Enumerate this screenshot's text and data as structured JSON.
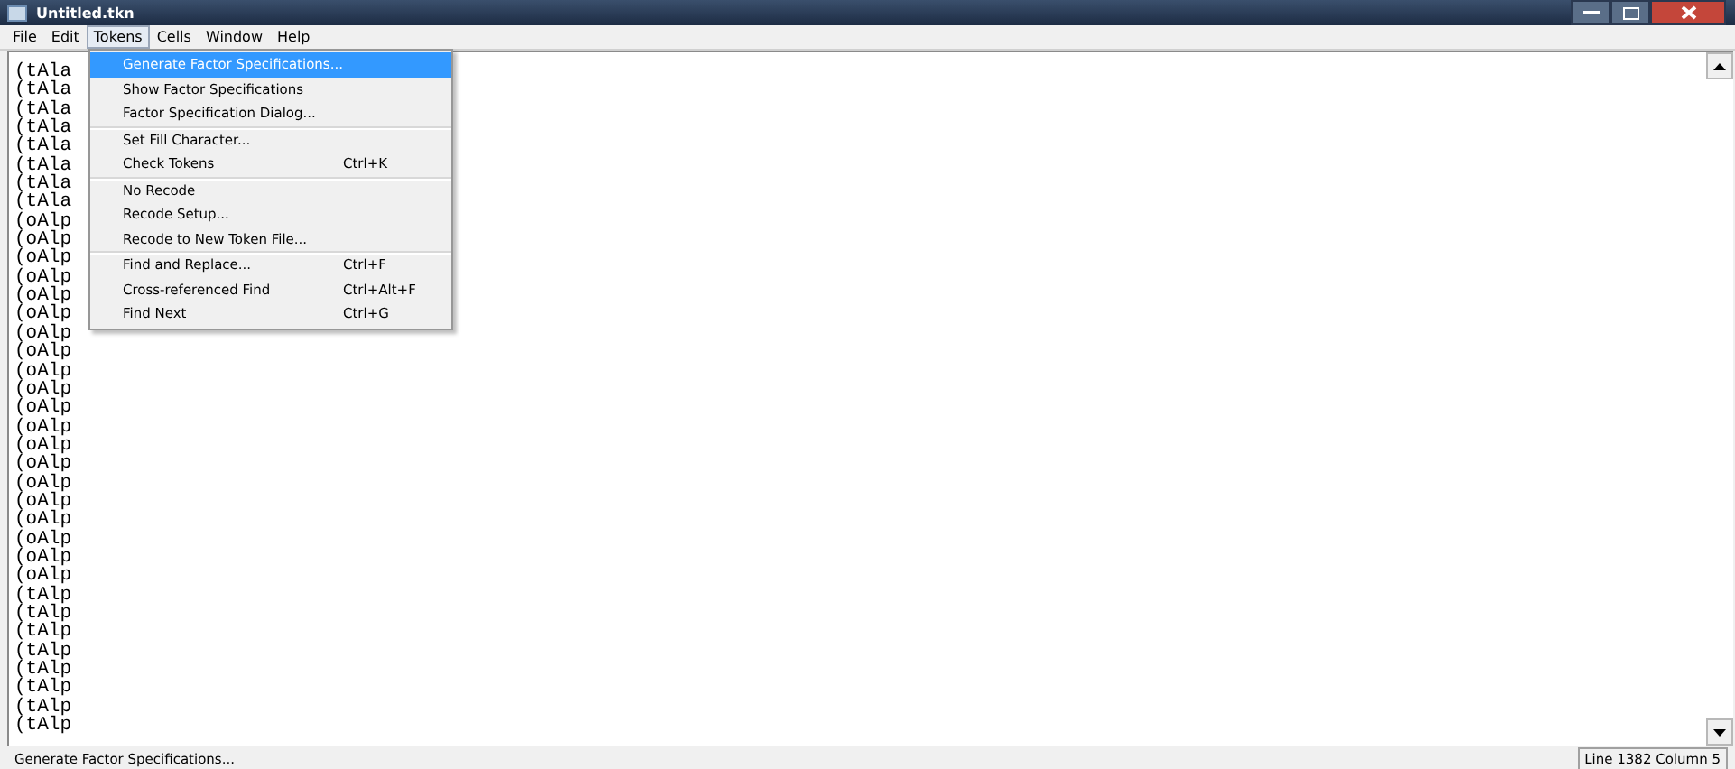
{
  "window": {
    "title": "Untitled.tkn"
  },
  "menu_bar": [
    {
      "label": "File",
      "selected": false
    },
    {
      "label": "Edit",
      "selected": false
    },
    {
      "label": "Tokens",
      "selected": true
    },
    {
      "label": "Cells",
      "selected": false
    },
    {
      "label": "Window",
      "selected": false
    },
    {
      "label": "Help",
      "selected": false
    }
  ],
  "dropdown": {
    "groups": [
      [
        {
          "label": "Generate Factor Specifications...",
          "selected": true
        },
        {
          "label": "Show Factor Specifications",
          "selected": false
        },
        {
          "label": "Factor Specification Dialog...",
          "selected": false
        }
      ],
      [
        {
          "label": "Set Fill Character...",
          "selected": false
        },
        {
          "label": "Check Tokens",
          "shortcut": "Ctrl+K",
          "selected": false
        }
      ],
      [
        {
          "label": "No Recode",
          "selected": false
        },
        {
          "label": "Recode Setup...",
          "selected": false
        },
        {
          "label": "Recode to New Token File...",
          "selected": false
        }
      ],
      [
        {
          "label": "Find and Replace...",
          "shortcut": "Ctrl+F",
          "selected": false
        },
        {
          "label": "Cross-referenced Find",
          "shortcut": "Ctrl+Alt+F",
          "selected": false
        },
        {
          "label": "Find Next",
          "shortcut": "Ctrl+G",
          "selected": false
        }
      ]
    ]
  },
  "editor": {
    "lines": [
      "(tAla",
      "(tAla",
      "(tAla",
      "(tAla",
      "(tAla",
      "(tAla",
      "(tAla",
      "(tAla",
      "(oAlp",
      "(oAlp",
      "(oAlp",
      "(oAlp",
      "(oAlp",
      "(oAlp",
      "(oAlp",
      "(oAlp",
      "(oAlp",
      "(oAlp",
      "(oAlp",
      "(oAlp",
      "(oAlp",
      "(oAlp",
      "(oAlp",
      "(oAlp",
      "(oAlp",
      "(oAlp",
      "(oAlp",
      "(oAlp",
      "(tAlp",
      "(tAlp",
      "(tAlp",
      "(tAlp",
      "(tAlp",
      "(tAlp",
      "(tAlp",
      "(tAlp"
    ]
  },
  "status_bar": {
    "message": "Generate Factor Specifications...",
    "position": "Line 1382 Column 5"
  }
}
